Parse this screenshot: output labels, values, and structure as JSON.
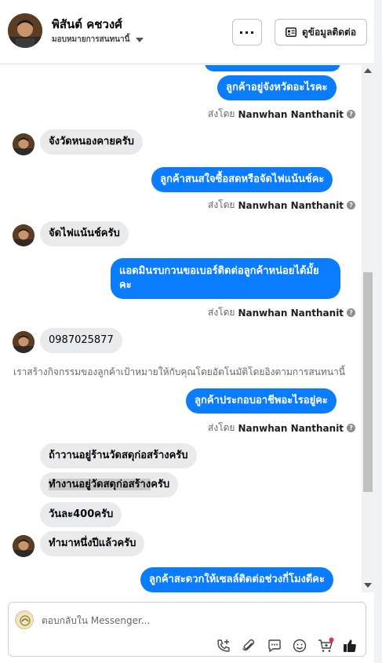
{
  "header": {
    "contact_name": "พิสันต์ คชวงศ์",
    "assign_label": "มอบหมายการสนทนานี้",
    "more_label": "···",
    "info_button": "ดูข้อมูลติดต่อ"
  },
  "messages": {
    "m1": "ลูกค้าอยู่จังหวัดอะไรคะ",
    "m2": "จังวัดหนองคายครับ",
    "m3": "ลูกค้าสนสใจซื้อสดหรือจัดไฟแน้นช์คะ",
    "m4": "จัดไฟแน้นช์ครับ",
    "m5_line1": "แอดมินรบกวนขอเบอร์ติดต่อลูกค้าหน่อยได้มั้ย",
    "m5_line2": "คะ",
    "m6": "0987025877",
    "m7": "ลูกค้าประกอบอาชีพอะไรอยู่คะ",
    "m8": "ถ้าวานอยู่ร้านวัดสดุก่อสร้างครับ",
    "m9_highlight": "ทำงานอยู่วัดสดุก่อสร้าง",
    "m9_rest": "ครับ",
    "m10": "วันละ400ครับ",
    "m11": "ทำมาหนึ่งปีแล้วครับ",
    "m12": "ลูกค้าสะดวกให้เซลล์ติดต่อช่วงกี่โมงดีคะ"
  },
  "sent_by": {
    "prefix": "ส่งโดย",
    "name": "Nanwhan Nanthanit",
    "info": "?"
  },
  "system_note": "เราสร้างกิจกรรมของลูกค้าเป้าหมายให้กับคุณโดยอัตโนมัติโดยอิงตามการสนทนานี้",
  "composer": {
    "placeholder": "ตอบกลับใน Messenger..."
  },
  "colors": {
    "outgoing_bubble": "#0a7cff",
    "incoming_bubble": "#e9eaec",
    "like_icon": "#1c1e21"
  }
}
